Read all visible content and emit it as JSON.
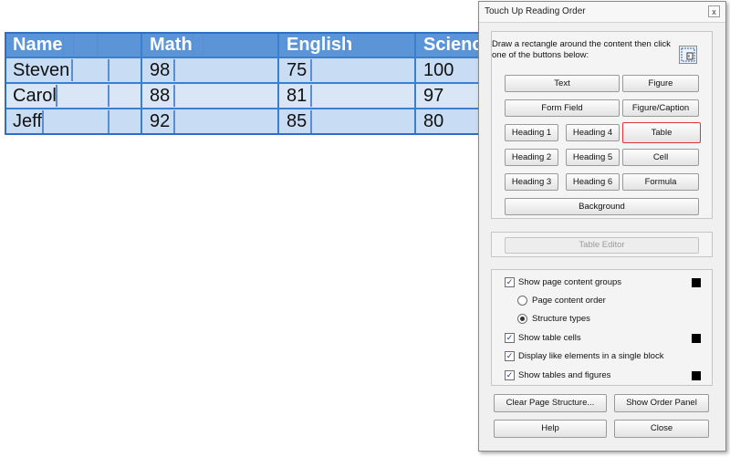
{
  "table": {
    "headers": [
      "Name",
      "Math",
      "English",
      "Science"
    ],
    "rows": [
      [
        "Steven",
        "98",
        "75",
        "100"
      ],
      [
        "Carol",
        "88",
        "81",
        "97"
      ],
      [
        "Jeff",
        "92",
        "85",
        "80"
      ]
    ],
    "highlight_color": "#5b95d8"
  },
  "dialog": {
    "title": "Touch Up Reading Order",
    "close": "x",
    "instruction": "Draw a rectangle around the content then click one of the buttons below:",
    "buttons": {
      "text": "Text",
      "figure": "Figure",
      "form_field": "Form Field",
      "figure_caption": "Figure/Caption",
      "heading1": "Heading 1",
      "heading4": "Heading 4",
      "table": "Table",
      "heading2": "Heading 2",
      "heading5": "Heading 5",
      "cell": "Cell",
      "heading3": "Heading 3",
      "heading6": "Heading 6",
      "formula": "Formula",
      "background": "Background"
    },
    "table_editor": "Table Editor",
    "options": {
      "show_groups": "Show page content groups",
      "page_content_order": "Page content order",
      "structure_types": "Structure types",
      "show_table_cells": "Show table cells",
      "display_like": "Display like elements in a single block",
      "show_tables_figures": "Show tables and figures"
    },
    "footer": {
      "clear": "Clear Page Structure...",
      "show_order": "Show Order Panel",
      "help": "Help",
      "close": "Close"
    },
    "selected_button_border": "#e0323a",
    "check_mark": "✓"
  }
}
